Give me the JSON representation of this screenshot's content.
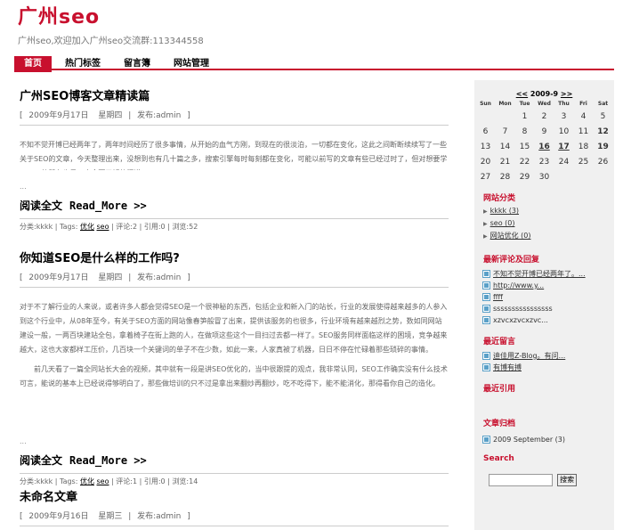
{
  "site": {
    "title": "广州seo",
    "description": "广州seo,欢迎加入广州seo交流群:113344558"
  },
  "nav": [
    "首页",
    "热门标签",
    "留言簿",
    "网站管理"
  ],
  "posts": [
    {
      "title": "广州SEO博客文章精读篇",
      "date": "2009年9月17日",
      "weekday": "星期四",
      "author": "发布:admin",
      "paragraphs": [
        "不知不觉开博已经两年了，两年时间经历了很多事情，从开始的血气方刚，到现在的很淡泊，一切都在变化，这此之间断断续续写了一些关于SEO的文章，今天整理出来，没想到也有几十篇之多，搜索引擎每时每刻都在变化，可能以前写的文章有些已经过时了，但对想要学习SEO的朋友也是一个全面了解的渠道。"
      ],
      "dots": "...",
      "readmore": "阅读全文",
      "readmore_link": "Read_More >>",
      "foot": {
        "category": "分类:kkkk",
        "tags_label": "Tags:",
        "tag1": "优化",
        "tag2": "seo",
        "comments": "评论:2",
        "trackbacks": "引用:0",
        "views": "浏览:52"
      }
    },
    {
      "title": "你知道SEO是什么样的工作吗?",
      "date": "2009年9月17日",
      "weekday": "星期四",
      "author": "发布:admin",
      "paragraphs": [
        "对于不了解行业的人来说，或者许多人都会觉得SEO是一个很神秘的东西，包括企业和新入门的站长，行业的发展使得越来越多的人参入到这个行业中，从08年至今，有关于SEO方面的网站像春笋般冒了出来，提供该服务的也很多，行业环境有越来越烈之势，数如同网站建设一般，一两百块建站全包，拿着椅子在街上跑的人，在做项这些这个一目扫过去都一样了。SEO服务同样面临这样的困境，竞争越来越大，这也大家都样工压价，几百块一个关键词的单子不在少数，如此一来，人家真被了机器，日日不停在忙碌着那些琐碎的事情。",
        "前几天看了一篇全同站长大会的视频，其中就有一段是讲SEO优化的，当中很跟提的观点，我非常认同，SEO工作确实没有什么技术可言，能说的基本上已经说得够明白了，那些做培训的只不过是拿出来翻炒再翻炒，吃不吃得下，能不能消化，那得看你自己的造化。"
      ],
      "dots": "...",
      "readmore": "阅读全文",
      "readmore_link": "Read_More >>",
      "foot": {
        "category": "分类:kkkk",
        "tags_label": "Tags:",
        "tag1": "优化",
        "tag2": "seo",
        "comments": "评论:1",
        "trackbacks": "引用:0",
        "views": "浏览:14"
      }
    },
    {
      "title": "未命名文章",
      "date": "2009年9月16日",
      "weekday": "星期三",
      "author": "发布:admin"
    }
  ],
  "calendar": {
    "prev": "<<",
    "title": "2009-9",
    "next": ">>",
    "weekdays": [
      "Sun",
      "Mon",
      "Tue",
      "Wed",
      "Thu",
      "Fri",
      "Sat"
    ],
    "weeks": [
      [
        "",
        "",
        "1",
        "2",
        "3",
        "4",
        "5"
      ],
      [
        "6",
        "7",
        "8",
        "9",
        "10",
        "11",
        "12"
      ],
      [
        "13",
        "14",
        "15",
        "16",
        "17",
        "18",
        "19"
      ],
      [
        "20",
        "21",
        "22",
        "23",
        "24",
        "25",
        "26"
      ],
      [
        "27",
        "28",
        "29",
        "30",
        "",
        "",
        ""
      ]
    ],
    "linked_days": [
      "16",
      "17"
    ],
    "bold_days": [
      "12",
      "19"
    ]
  },
  "categories": {
    "heading": "网站分类",
    "items": [
      "kkkk (3)",
      "seo (0)",
      "网站优化 (0)"
    ]
  },
  "comments": {
    "heading": "最新评论及回复",
    "items": [
      "不知不觉开博已经两年了。...",
      "http://www.y...",
      "ffff",
      "ssssssssssssssss",
      "xzvcxzvcxzvc..."
    ]
  },
  "guestbook": {
    "heading": "最近留言",
    "items": [
      "迪佳用Z-Blog。有问...",
      "有博有搏"
    ]
  },
  "trackbacks": {
    "heading": "最近引用"
  },
  "archives": {
    "heading": "文章归档",
    "items": [
      "2009 September (3)"
    ]
  },
  "search": {
    "heading": "Search",
    "button": "搜索"
  },
  "colors": {
    "accent": "#c8102e",
    "sidebar_bg": "#f0f0f0"
  }
}
